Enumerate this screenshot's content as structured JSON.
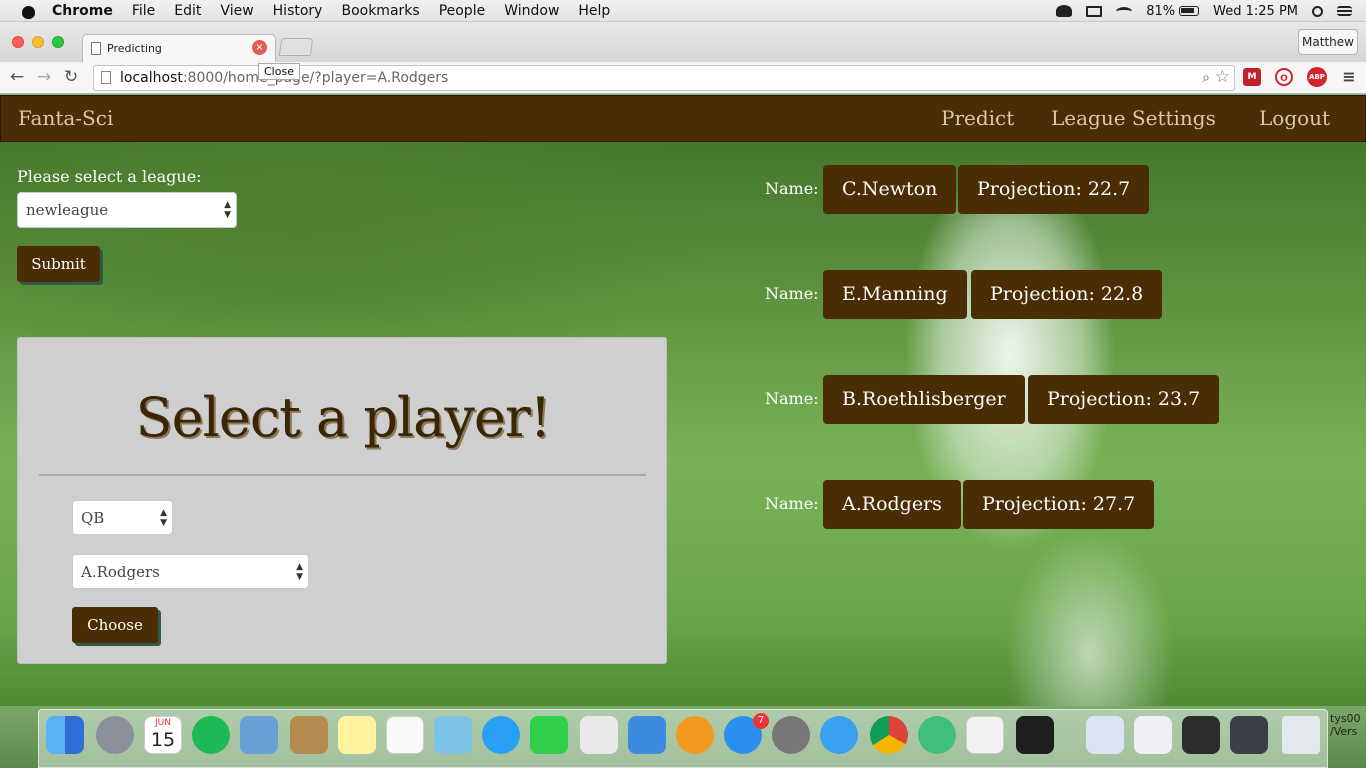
{
  "menubar": {
    "app": "Chrome",
    "items": [
      "File",
      "Edit",
      "View",
      "History",
      "Bookmarks",
      "People",
      "Window",
      "Help"
    ],
    "battery": "81%",
    "clock": "Wed 1:25 PM"
  },
  "browser": {
    "tab_title": "Predicting",
    "close_tooltip": "Close",
    "user": "Matthew",
    "url_host": "localhost",
    "url_rest": ":8000/home_page/?player=A.Rodgers",
    "extensions": [
      "M",
      "O",
      "ABP"
    ]
  },
  "nav": {
    "brand": "Fanta-Sci",
    "links": [
      "Predict",
      "League Settings",
      "Logout"
    ]
  },
  "league": {
    "label": "Please select a league:",
    "selected": "newleague",
    "submit": "Submit"
  },
  "player_card": {
    "title": "Select a player!",
    "position": "QB",
    "player": "A.Rodgers",
    "choose": "Choose"
  },
  "results": {
    "name_label": "Name:",
    "projection_prefix": "Projection:",
    "rows": [
      {
        "name": "C.Newton",
        "projection": "Projection: 22.7"
      },
      {
        "name": "E.Manning",
        "projection": "Projection: 22.8"
      },
      {
        "name": "B.Roethlisberger",
        "projection": "Projection: 23.7"
      },
      {
        "name": "A.Rodgers",
        "projection": "Projection: 27.7"
      }
    ]
  },
  "dock": {
    "calendar_month": "JUN",
    "calendar_day": "15",
    "appstore_badge": "7",
    "edge_text": "tys00\n/Vers"
  }
}
